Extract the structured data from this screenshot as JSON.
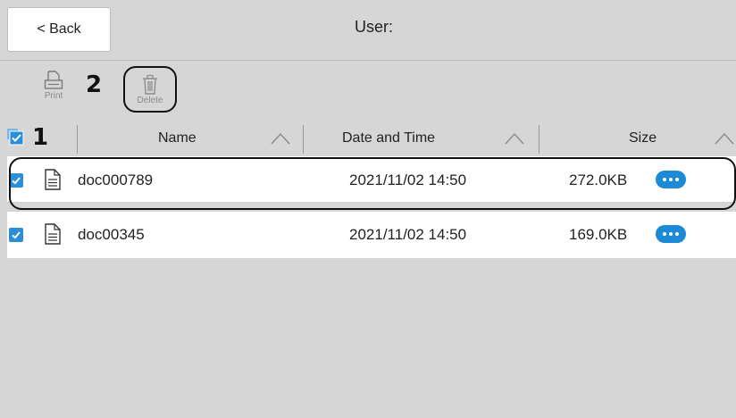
{
  "header": {
    "back_label": "< Back",
    "title": "User:"
  },
  "toolbar": {
    "print_label": "Print",
    "delete_label": "Delete"
  },
  "callouts": {
    "one": "1",
    "two": "2"
  },
  "table": {
    "columns": [
      "Name",
      "Date and Time",
      "Size"
    ],
    "rows": [
      {
        "name": "doc000789",
        "datetime": "2021/11/02 14:50",
        "size": "272.0KB",
        "checked": true
      },
      {
        "name": "doc00345",
        "datetime": "2021/11/02 14:50",
        "size": "169.0KB",
        "checked": true
      }
    ]
  },
  "colors": {
    "accent": "#1d8ad6",
    "background": "#d6d6d6"
  },
  "icons": [
    "print-icon",
    "delete-icon",
    "document-icon",
    "more-options-icon",
    "sort-up-icon",
    "checkbox-checked-icon"
  ]
}
